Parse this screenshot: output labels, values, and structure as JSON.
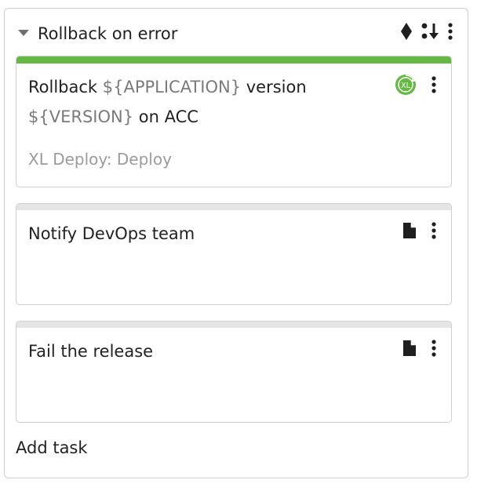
{
  "group": {
    "title": "Rollback on error",
    "icons": [
      "diamond-icon",
      "sort-icon",
      "more-vertical-icon"
    ]
  },
  "tasks": [
    {
      "title_parts": [
        "Rollback ",
        "${APPLICATION}",
        " version ",
        "${VERSION}",
        " on ACC"
      ],
      "type": "XL Deploy: Deploy",
      "status_color": "#64b843",
      "icon": "xl-deploy-icon",
      "icon_label": "XL"
    },
    {
      "title": "Notify DevOps team",
      "icon": "document-icon"
    },
    {
      "title": "Fail the release",
      "icon": "document-icon"
    }
  ],
  "add_task_label": "Add task"
}
